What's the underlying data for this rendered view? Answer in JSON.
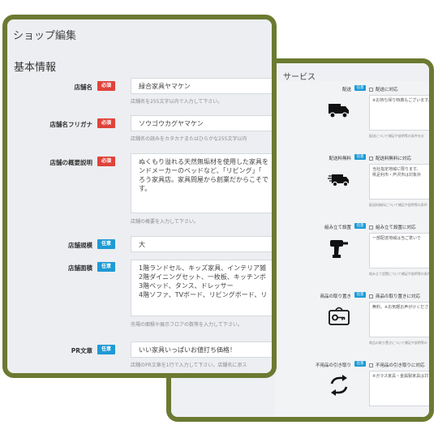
{
  "front": {
    "page_title": "ショップ編集",
    "section_title": "基本情報",
    "fields": [
      {
        "label": "店舗名",
        "badge": "必須",
        "value": "緑合家具ヤマケン",
        "help": "店舗名を255文字以内で入力して下さい。"
      },
      {
        "label": "店舗名フリガナ",
        "badge": "必須",
        "value": "ソウゴウカグヤマケン",
        "help": "店舗名の読みをカタカナまたはひらがな255文字以内"
      },
      {
        "label": "店舗の概要説明",
        "badge": "必須",
        "value": "ぬくもり溢れる天然無垢材を使用した家具を\nンドメーカーのベッドなど、「リビング」「\nろう家具店。家具問屋から創業だからこそで\nす。",
        "help": "店舗の概要を入力して下さい。"
      },
      {
        "label": "店舗規模",
        "badge": "任意",
        "value": "大",
        "help": ""
      },
      {
        "label": "店舗面積",
        "badge": "任意",
        "value": "1階ランドセル、キッズ家具、インテリア雑\n2階ダイニングセット、一枚板、キッチンボ\n3階ベッド、タンス、ドレッサー\n4階ソファ、TVボード、リビングボード、リ",
        "help": "売場の面積や展示フロアの数等を入力して下さい。"
      },
      {
        "label": "PR文章",
        "badge": "任意",
        "value": "いい家具いっぱいお値打ち価格！",
        "help": "店舗のPR文章を1行で入力して下さい。店舗名に添ス"
      }
    ]
  },
  "back": {
    "title": "サービス",
    "services": [
      {
        "label": "配送",
        "tag": "任意",
        "check_label": "配送に対応",
        "text": "※お持ち帰り特典もございます。",
        "note": "配送について補足や説明等の条件をお",
        "icon": "truck-icon"
      },
      {
        "label": "配送料無料",
        "tag": "任意",
        "check_label": "配送料無料に対応",
        "text": "当社指定地域に限ります。\n県足利市・芦沢市は対象外",
        "note": "配送料無料について補足や説明等の条件",
        "icon": "free-shipping-truck-icon"
      },
      {
        "label": "組み立て設置",
        "tag": "任意",
        "check_label": "組み立て設置に対応",
        "text": "一部配達地域は当ご意いで",
        "note": "組み立て設置について補足や説明等の条件",
        "icon": "drill-icon"
      },
      {
        "label": "商品の取り置き",
        "tag": "任意",
        "check_label": "商品の取り置きに対応",
        "text": "無料。※お気軽お声がけくださ",
        "note": "商品の取り置きについて補足や説明等の",
        "icon": "keep-key-icon"
      },
      {
        "label": "不用品の引き取り",
        "tag": "任意",
        "check_label": "不用品の引き取りに対応",
        "text": "※ガラス家具・金属製家具は対",
        "note": "",
        "icon": "recycle-arrows-icon"
      }
    ]
  },
  "colors": {
    "frame": "#6b7a32",
    "required": "#e0433b",
    "optional": "#1e9ad6"
  }
}
